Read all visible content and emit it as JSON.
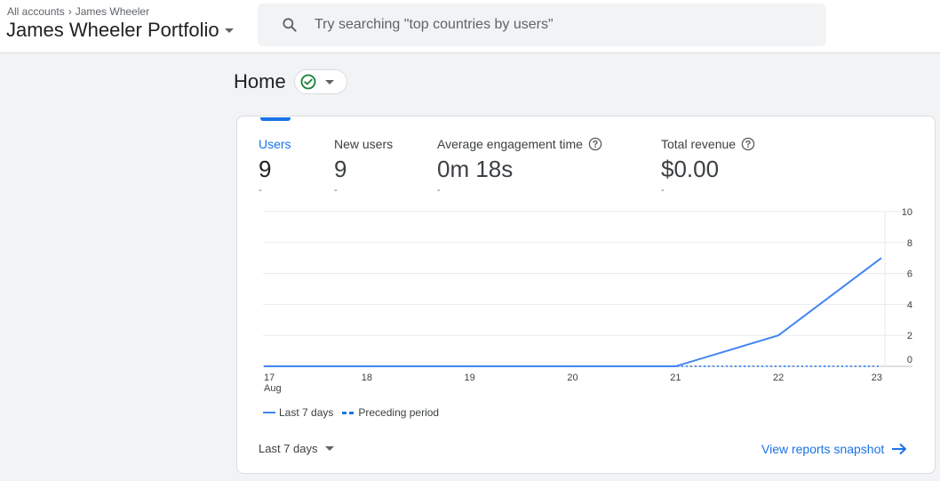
{
  "header": {
    "breadcrumb": {
      "all_accounts": "All accounts",
      "account": "James Wheeler"
    },
    "property_name": "James Wheeler Portfolio"
  },
  "search": {
    "placeholder": "Try searching \"top countries by users\""
  },
  "page": {
    "title": "Home"
  },
  "metrics": [
    {
      "label": "Users",
      "value": "9",
      "change": "-"
    },
    {
      "label": "New users",
      "value": "9",
      "change": "-"
    },
    {
      "label": "Average engagement time",
      "value": "0m 18s",
      "change": "-"
    },
    {
      "label": "Total revenue",
      "value": "$0.00",
      "change": "-"
    }
  ],
  "chart_data": {
    "type": "line",
    "x": [
      "17\nAug",
      "18",
      "19",
      "20",
      "21",
      "22",
      "23"
    ],
    "series": [
      {
        "name": "Last 7 days",
        "values": [
          0,
          0,
          0,
          0,
          0,
          2,
          7
        ],
        "style": "solid",
        "color": "#4285f4"
      },
      {
        "name": "Preceding period",
        "values": [
          0,
          0,
          0,
          0,
          0,
          0,
          0
        ],
        "style": "dashed",
        "color": "#1a73e8"
      }
    ],
    "y_ticks": [
      "10",
      "8",
      "6",
      "4",
      "2",
      "0"
    ],
    "ylim": [
      0,
      10
    ],
    "legend_position": "bottom-left",
    "grid": true
  },
  "footer": {
    "period_label": "Last 7 days",
    "link_label": "View reports snapshot"
  },
  "colors": {
    "accent": "#1a73e8",
    "line": "#4285f4",
    "success": "#188038"
  }
}
